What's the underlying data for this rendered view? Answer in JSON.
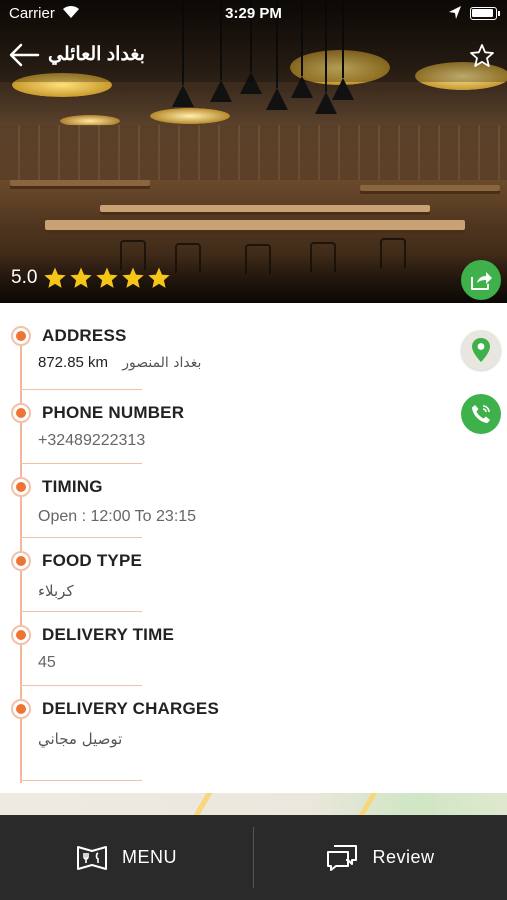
{
  "status_bar": {
    "carrier": "Carrier",
    "time": "3:29 PM"
  },
  "header": {
    "title": "بغداد العائلي",
    "rating": "5.0",
    "stars": 5
  },
  "details": {
    "address": {
      "label": "ADDRESS",
      "distance": "872.85 km",
      "area": "بغداد المنصور"
    },
    "phone": {
      "label": "PHONE NUMBER",
      "value": "+32489222313"
    },
    "timing": {
      "label": "TIMING",
      "value": "Open : 12:00 To 23:15"
    },
    "food_type": {
      "label": "FOOD TYPE",
      "value": "كربلاء"
    },
    "delivery_time": {
      "label": "DELIVERY TIME",
      "value": "45"
    },
    "delivery_charges": {
      "label": "DELIVERY CHARGES",
      "value": "توصيل مجاني"
    }
  },
  "tabbar": {
    "menu_label": "MENU",
    "review_label": "Review"
  },
  "colors": {
    "accent": "#ee7436",
    "green": "#3fb14a",
    "tabbar": "#2a2a2a",
    "star": "#f5c518"
  },
  "icons": [
    "back-arrow-icon",
    "favorite-star-icon",
    "rating-star-icon",
    "share-icon",
    "map-pin-icon",
    "phone-icon",
    "menu-icon",
    "review-chat-icon"
  ]
}
